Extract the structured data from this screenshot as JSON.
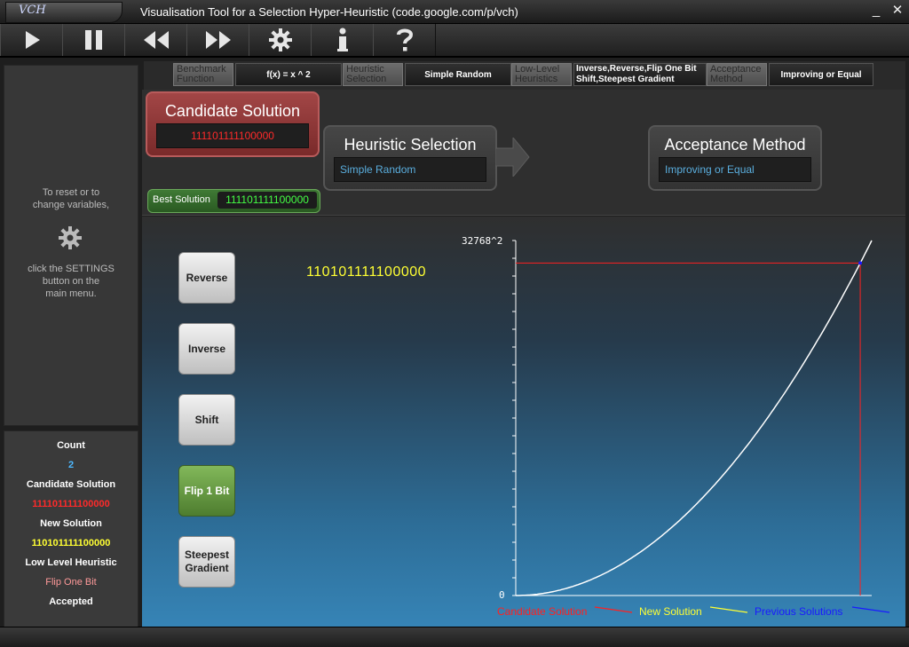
{
  "window": {
    "logo": "VCH",
    "title": "Visualisation Tool for a Selection Hyper-Heuristic (code.google.com/p/vch)",
    "minimize": "_",
    "close": "✕"
  },
  "toolbar": {
    "buttons": [
      "play-icon",
      "pause-icon",
      "rewind-icon",
      "fast-forward-icon",
      "gear-icon",
      "info-icon",
      "help-icon"
    ]
  },
  "settings_bar": {
    "benchmark_label": "Benchmark Function",
    "benchmark_value": "f(x) = x ^ 2",
    "heuristic_selection_label": "Heuristic Selection",
    "heuristic_selection_value": "Simple Random",
    "low_level_label": "Low-Level Heuristics",
    "low_level_value_line1": "Inverse,Reverse,Flip One Bit",
    "low_level_value_line2": "Shift,Steepest Gradient",
    "acceptance_label": "Acceptance Method",
    "acceptance_value": "Improving or Equal"
  },
  "left_panel": {
    "hint_line1": "To reset or to",
    "hint_line2": "change variables,",
    "hint_line3": "click the SETTINGS",
    "hint_line4": "button on the",
    "hint_line5": "main menu."
  },
  "stats": {
    "count_label": "Count",
    "count_value": "2",
    "candidate_label": "Candidate Solution",
    "candidate_value": "111101111100000",
    "new_label": "New Solution",
    "new_value": "110101111100000",
    "llh_label": "Low Level Heuristic",
    "llh_value": "Flip One Bit",
    "status": "Accepted"
  },
  "flow": {
    "candidate_title": "Candidate Solution",
    "candidate_value": "111101111100000",
    "selection_title": "Heuristic Selection",
    "selection_value": "Simple Random",
    "acceptance_title": "Acceptance Method",
    "acceptance_value": "Improving or Equal",
    "best_label": "Best Solution",
    "best_value": "111101111100000"
  },
  "heuristics": {
    "reverse": "Reverse",
    "inverse": "Inverse",
    "shift": "Shift",
    "flip": "Flip 1 Bit",
    "steepest_line1": "Steepest",
    "steepest_line2": "Gradient",
    "active": "Flip 1 Bit"
  },
  "plot": {
    "new_solution_display": "110101111100000"
  },
  "chart_data": {
    "type": "line",
    "function": "f(x) = x ^ 2",
    "xlim": [
      0,
      32768
    ],
    "ylim": [
      0,
      1073741824
    ],
    "y_max_label": "32768^2",
    "y_min_label": "0",
    "candidate_x": 31712,
    "series": [
      {
        "name": "Candidate Solution",
        "color": "#ff2020"
      },
      {
        "name": "New Solution",
        "color": "#ffff33"
      },
      {
        "name": "Previous Solutions",
        "color": "#1a1aff"
      }
    ],
    "curve_color": "#ffffff"
  }
}
